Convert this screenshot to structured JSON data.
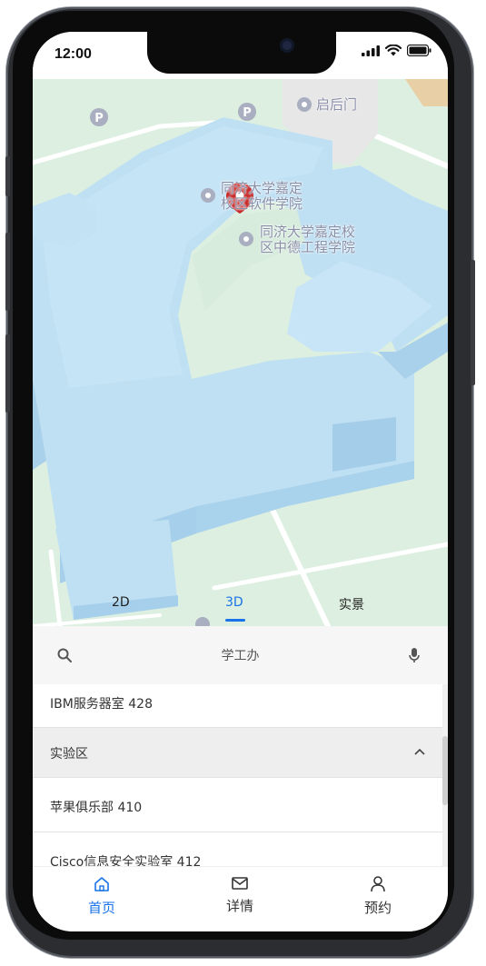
{
  "status_bar": {
    "time": "12:00"
  },
  "map": {
    "labels": {
      "gate": "启后门",
      "software_school_line1": "同济大学嘉定",
      "software_school_line2": "校区软件学院",
      "german_school_line1": "同济大学嘉定校",
      "german_school_line2": "区中德工程学院"
    },
    "view_tabs": [
      "2D",
      "3D",
      "实景"
    ],
    "active_view": "3D"
  },
  "search": {
    "query": "学工办"
  },
  "list": {
    "rows": [
      "IBM服务器室 428",
      "实验区",
      "苹果俱乐部 410",
      "Cisco信息安全实验室 412"
    ]
  },
  "bottom_nav": {
    "items": [
      {
        "label": "首页",
        "icon": "home-icon"
      },
      {
        "label": "详情",
        "icon": "mail-icon"
      },
      {
        "label": "预约",
        "icon": "person-icon"
      }
    ],
    "active_index": 0
  },
  "colors": {
    "accent": "#1a73e8",
    "map_building": "#bfe0f3",
    "map_ground": "#dcefe0",
    "marker": "#c62828"
  }
}
